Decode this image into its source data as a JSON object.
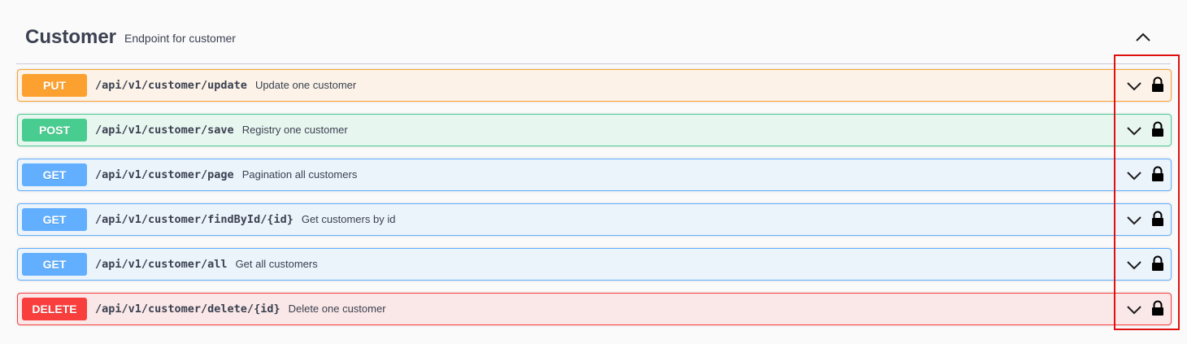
{
  "tag": {
    "title": "Customer",
    "description": "Endpoint for customer"
  },
  "colors": {
    "put": "#fca130",
    "post": "#49cc90",
    "get": "#61affe",
    "delete": "#f93e3e",
    "highlight": "#e01010",
    "text": "#3b4151"
  },
  "operations": [
    {
      "method": "PUT",
      "path": "/api/v1/customer/update",
      "summary": "Update one customer"
    },
    {
      "method": "POST",
      "path": "/api/v1/customer/save",
      "summary": "Registry one customer"
    },
    {
      "method": "GET",
      "path": "/api/v1/customer/page",
      "summary": "Pagination all customers"
    },
    {
      "method": "GET",
      "path": "/api/v1/customer/findById/{id}",
      "summary": "Get customers by id"
    },
    {
      "method": "GET",
      "path": "/api/v1/customer/all",
      "summary": "Get all customers"
    },
    {
      "method": "DELETE",
      "path": "/api/v1/customer/delete/{id}",
      "summary": "Delete one customer"
    }
  ],
  "icons": {
    "collapse": "chevron-up-icon",
    "expand": "chevron-down-icon",
    "auth": "lock-icon"
  }
}
